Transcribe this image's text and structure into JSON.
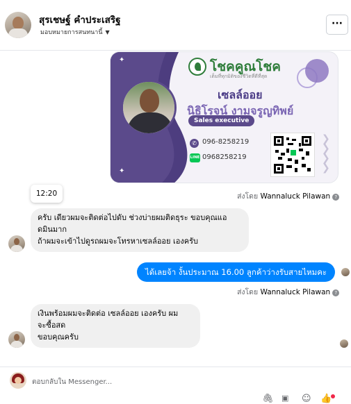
{
  "header": {
    "name": "สุรเชษฐ์ คำประเสริฐ",
    "subtitle": "มอบหมายการสนทนานี้",
    "more_label": "···"
  },
  "card": {
    "brand": "โชคคูณโชค",
    "tagline": "เต็มที่ทุกมิติของชีวิตที่ดีที่สุด",
    "title": "เซลล์ออย",
    "person_name": "นิธิโรจน์ งามจรูญทิพย์",
    "position": "Sales executive",
    "phone": "096-8258219",
    "line_label": "LINE",
    "line_id": "0968258219"
  },
  "messages": {
    "sent_by_prefix": "ส่งโดย",
    "sent_by_name": "Wannaluck Pilawan",
    "time": "12:20",
    "incoming_1": [
      "ครับ เดียวผมจะติดต่อไปดับ ช่วงบ่ายผมติดธุระ ขอบคุณแอ",
      "ดมินมาก",
      "ถ้าผมจะเข้าไปดูรถผมจะโทรหาเซลล์ออย เองครับ"
    ],
    "outgoing_1": "ได้เลยจ้า งั้นประมาณ 16.00 ลูกค้าว่างรับสายไหมคะ",
    "incoming_2": [
      "เงินพร้อมผมจะติดต่อ เซลล์ออย เองครับ ผม",
      "จะซื้อสด",
      "ขอบคุณครับ"
    ]
  },
  "composer": {
    "placeholder": "ตอบกลับใน Messenger..."
  },
  "icons": {
    "attach": "paperclip-icon",
    "gif": "gif-icon",
    "emoji": "emoji-icon",
    "like": "like-icon"
  }
}
